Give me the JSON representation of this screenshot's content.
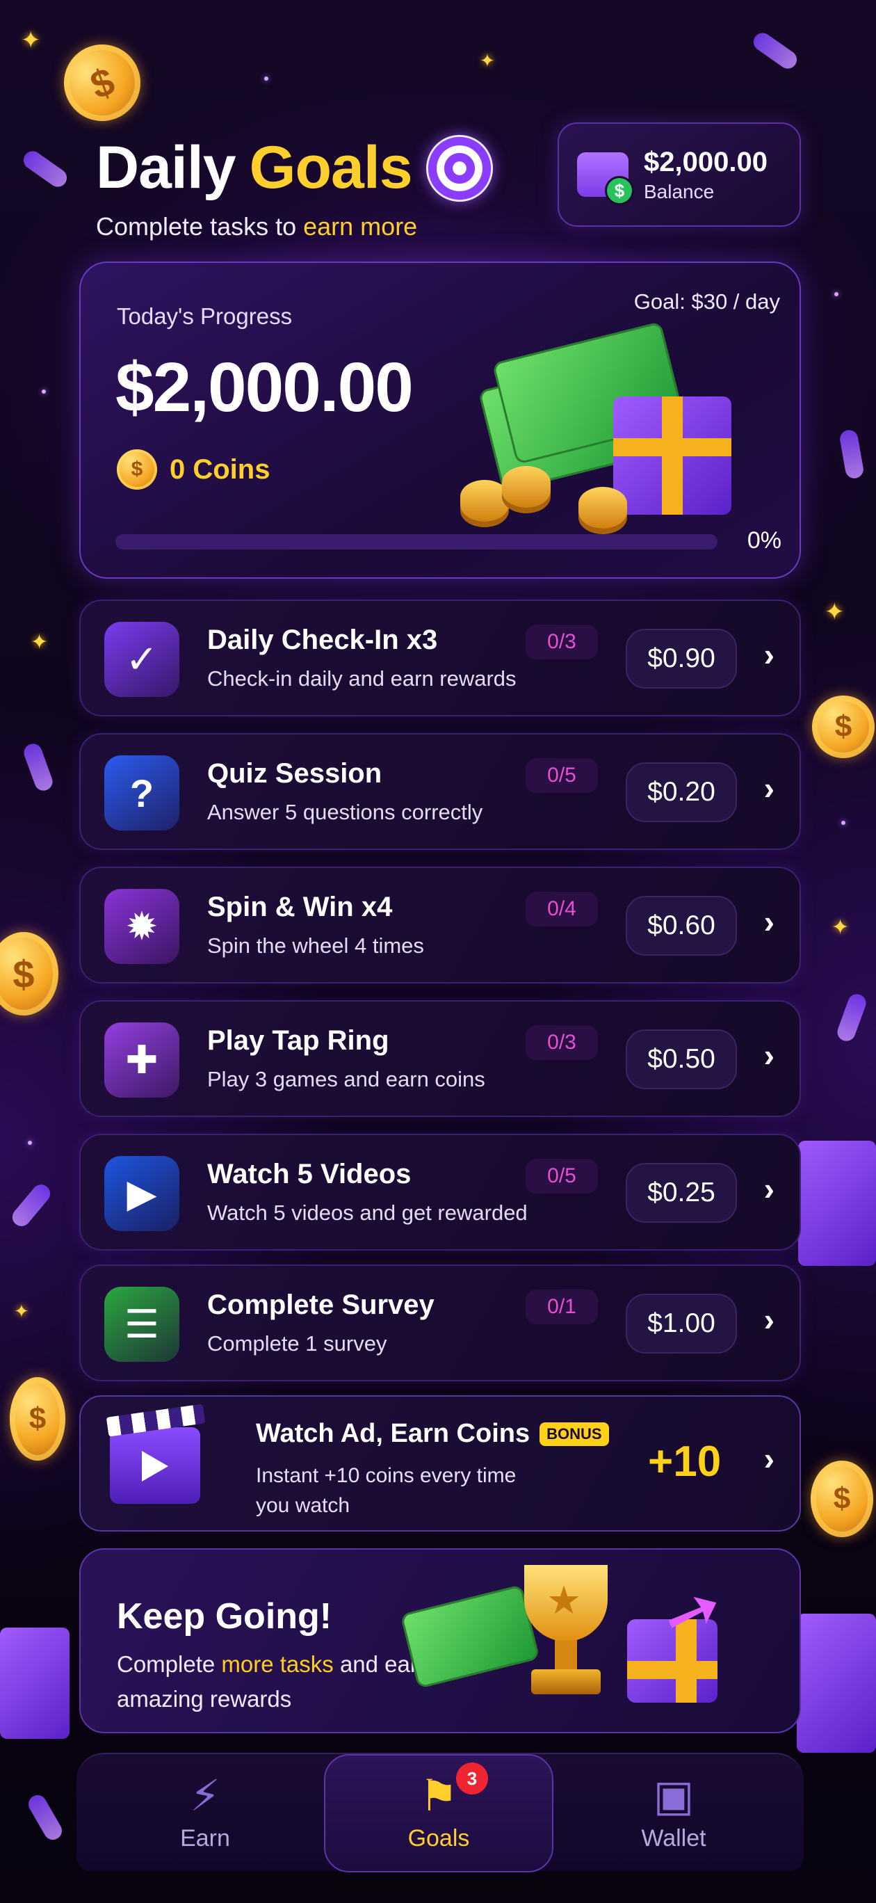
{
  "header": {
    "title_part1": "Daily",
    "title_part2": "Goals",
    "subtitle_part1": "Complete tasks to ",
    "subtitle_highlight": "earn more",
    "target_icon": "target-icon"
  },
  "balance": {
    "amount": "$2,000.00",
    "label": "Balance",
    "icon": "wallet-icon",
    "dollar_glyph": "$"
  },
  "progress": {
    "label": "Today's Progress",
    "goal": "Goal: $30 / day",
    "amount": "$2,000.00",
    "coins": "0 Coins",
    "percent_text": "0%",
    "percent_value": 0,
    "coin_glyph": "$"
  },
  "tasks": [
    {
      "title": "Daily Check-In x3",
      "desc": "Check-in daily and earn rewards",
      "badge": "0/3",
      "reward": "$0.90",
      "icon": "calendar-check-icon",
      "icon_bg": "#7b3cf0"
    },
    {
      "title": "Quiz Session",
      "desc": "Answer 5 questions correctly",
      "badge": "0/5",
      "reward": "$0.20",
      "icon": "question-icon",
      "icon_bg": "#2b5cf0"
    },
    {
      "title": "Spin & Win x4",
      "desc": "Spin the wheel 4 times",
      "badge": "0/4",
      "reward": "$0.60",
      "icon": "spin-wheel-icon",
      "icon_bg": "#8a34d8"
    },
    {
      "title": "Play Tap Ring",
      "desc": "Play 3 games and earn coins",
      "badge": "0/3",
      "reward": "$0.50",
      "icon": "gamepad-icon",
      "icon_bg": "#9440e0"
    },
    {
      "title": "Watch 5 Videos",
      "desc": "Watch 5 videos and get rewarded",
      "badge": "0/5",
      "reward": "$0.25",
      "icon": "play-video-icon",
      "icon_bg": "#1d56e0"
    },
    {
      "title": "Complete Survey",
      "desc": "Complete 1 survey",
      "badge": "0/1",
      "reward": "$1.00",
      "icon": "clipboard-icon",
      "icon_bg": "#2aa840"
    }
  ],
  "task_glyphs": [
    "✓",
    "?",
    "✹",
    "✚",
    "▶",
    "☰"
  ],
  "ad": {
    "title": "Watch Ad, Earn Coins",
    "badge": "BONUS",
    "desc": "Instant +10 coins every time you watch",
    "reward": "+10",
    "icon": "clapperboard-icon"
  },
  "keep_going": {
    "title": "Keep Going!",
    "desc_part1": "Complete ",
    "desc_highlight": "more tasks",
    "desc_part2": " and earn amazing rewards",
    "trophy_glyph": "★",
    "arrow_glyph": "➚"
  },
  "nav": {
    "items": [
      {
        "label": "Earn",
        "icon": "lightning-icon",
        "glyph": "⚡"
      },
      {
        "label": "Goals",
        "icon": "flag-icon",
        "glyph": "⚑",
        "badge": "3"
      },
      {
        "label": "Wallet",
        "icon": "wallet-icon",
        "glyph": "▣"
      }
    ]
  },
  "chevron": "›",
  "colors": {
    "accent": "#ffcf2e",
    "badge_text": "#e74fd0",
    "bg": "#0c0418"
  }
}
